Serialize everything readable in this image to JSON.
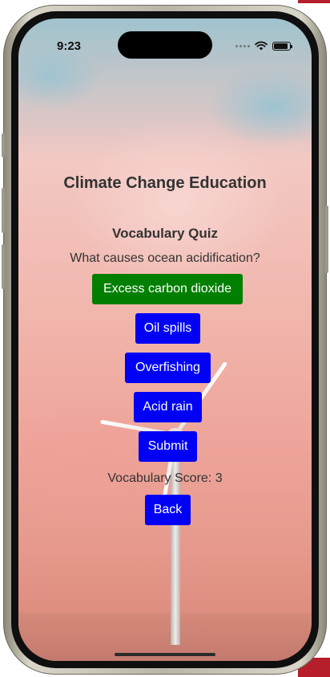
{
  "status_bar": {
    "time": "9:23"
  },
  "page": {
    "title": "Climate Change Education"
  },
  "quiz": {
    "title": "Vocabulary Quiz",
    "question": "What causes ocean acidification?",
    "options": [
      {
        "label": "Excess carbon dioxide",
        "color": "#007f00"
      },
      {
        "label": "Oil spills",
        "color": "#0000f5"
      },
      {
        "label": "Overfishing",
        "color": "#0000f5"
      },
      {
        "label": "Acid rain",
        "color": "#0000f5"
      }
    ],
    "submit_label": "Submit",
    "score_text": "Vocabulary Score: 3",
    "back_label": "Back"
  },
  "colors": {
    "primary_button": "#0000f5",
    "selected_button": "#007f00",
    "text": "#333333"
  },
  "icons": [
    "signal-dots-icon",
    "wifi-icon",
    "battery-icon"
  ]
}
